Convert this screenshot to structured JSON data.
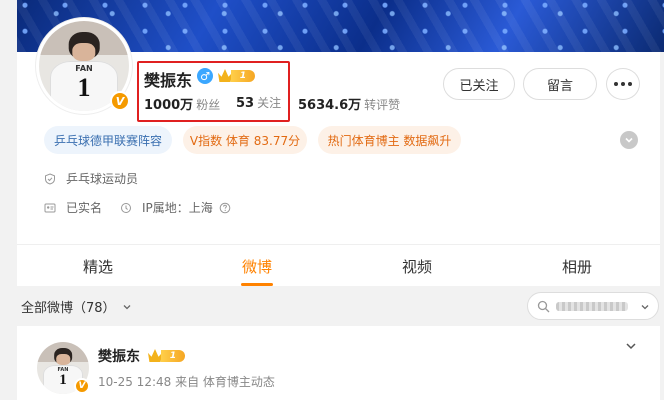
{
  "profile": {
    "name": "樊振东",
    "gender_icon": "♂",
    "verified_badge": "V",
    "level": "1",
    "stats": [
      {
        "value": "1000万",
        "label": "粉丝"
      },
      {
        "value": "53",
        "label": "关注"
      },
      {
        "value": "5634.6万",
        "label": "转评赞"
      }
    ],
    "avatar_jersey_text": "FAN",
    "avatar_jersey_number": "1"
  },
  "actions": {
    "follow_label": "已关注",
    "message_label": "留言"
  },
  "tags": [
    {
      "label": "乒乓球德甲联赛阵容",
      "style": "blue"
    },
    {
      "label": "V指数 体育 83.77分",
      "style": "orange"
    },
    {
      "label": "热门体育博主 数据飙升",
      "style": "orange"
    }
  ],
  "info": {
    "occupation": "乒乓球运动员",
    "verified": "已实名",
    "ip_location": "IP属地：上海"
  },
  "tabs": [
    {
      "label": "精选",
      "active": false
    },
    {
      "label": "微博",
      "active": true
    },
    {
      "label": "视频",
      "active": false
    },
    {
      "label": "相册",
      "active": false
    }
  ],
  "feed": {
    "filter_label": "全部微博（78）"
  },
  "post": {
    "author": "樊振东",
    "level": "1",
    "meta": "10-25 12:48 来自 体育博主动态"
  },
  "colors": {
    "accent": "#ff8200",
    "highlight_border": "#e02020",
    "verified_orange": "#f59a00"
  }
}
